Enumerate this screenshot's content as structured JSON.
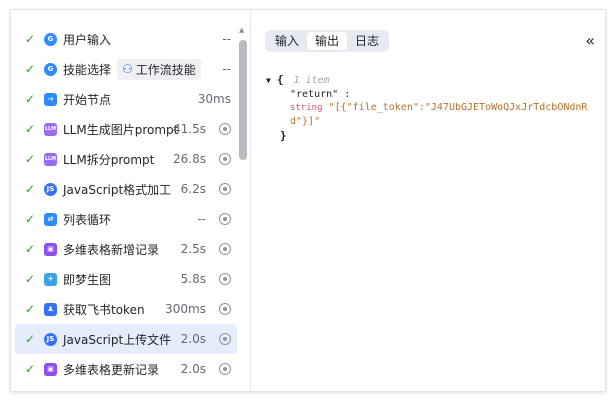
{
  "nodes": [
    {
      "label": "用户输入",
      "duration": "--",
      "icon": "globe-icon",
      "color": "#2f8bff",
      "locate": false
    },
    {
      "label": "技能选择",
      "tag": "工作流技能",
      "tag_icon": "workflow-icon",
      "duration": "--",
      "icon": "globe-icon",
      "color": "#2f8bff",
      "locate": false
    },
    {
      "label": "开始节点",
      "duration": "30ms",
      "icon": "enter-icon",
      "color": "#2f8bff",
      "locate": false
    },
    {
      "label": "LLM生成图片prompt",
      "duration": "41.5s",
      "icon": "llm-icon",
      "color": "#9b6bf2",
      "locate": true
    },
    {
      "label": "LLM拆分prompt",
      "duration": "26.8s",
      "icon": "llm-icon",
      "color": "#9b6bf2",
      "locate": true
    },
    {
      "label": "JavaScript格式加工",
      "duration": "6.2s",
      "icon": "js-icon",
      "color": "#3370ff",
      "locate": true
    },
    {
      "label": "列表循环",
      "duration": "--",
      "icon": "loop-icon",
      "color": "#2f8bff",
      "locate": true
    },
    {
      "label": "多维表格新增记录",
      "duration": "2.5s",
      "icon": "bitable-icon",
      "color": "#8e4ff0",
      "locate": true
    },
    {
      "label": "即梦生图",
      "duration": "5.8s",
      "icon": "dreamina-icon",
      "color": "#3aa3e8",
      "locate": true
    },
    {
      "label": "获取飞书token",
      "duration": "300ms",
      "icon": "feishu-icon",
      "color": "#3370ff",
      "locate": true
    },
    {
      "label": "JavaScript上传文件",
      "duration": "2.0s",
      "icon": "js-icon",
      "color": "#3370ff",
      "locate": true,
      "active": true
    },
    {
      "label": "多维表格更新记录",
      "duration": "2.0s",
      "icon": "bitable-icon",
      "color": "#8e4ff0",
      "locate": true
    }
  ],
  "tabs": [
    {
      "label": "输入",
      "selected": false
    },
    {
      "label": "输出",
      "selected": true
    },
    {
      "label": "日志",
      "selected": false
    }
  ],
  "collapse_label": "«",
  "check_mark": "✓",
  "output": {
    "open_brace": "{",
    "close_brace": "}",
    "item_count": "1 item",
    "key": "\"return\"",
    "colon": " :",
    "type": "string",
    "value_line1": "\"[{\"file_token\":\"J47UbGJEToWoQJxJrTdcbONdnR",
    "value_line2": "d\"}]\""
  },
  "colors": {
    "accent": "#3370ff",
    "success": "#2ea121",
    "active_row": "#e5ecfb"
  }
}
